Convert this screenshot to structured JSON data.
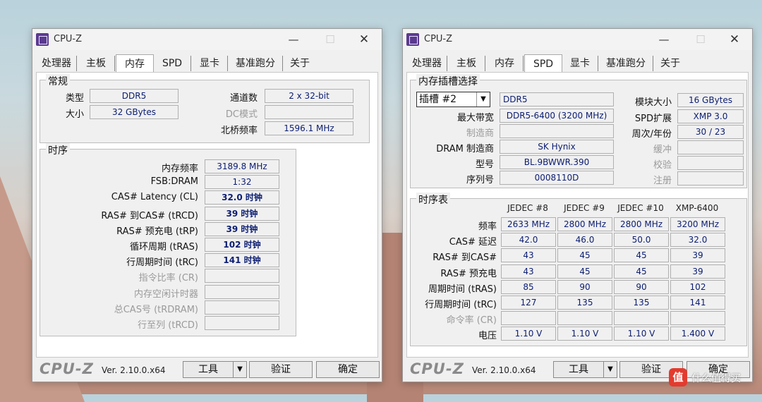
{
  "app_title": "CPU-Z",
  "win1": {
    "tabs": [
      "处理器",
      "主板",
      "内存",
      "SPD",
      "显卡",
      "基准跑分",
      "关于"
    ],
    "active_tab": "内存",
    "general": {
      "title": "常规",
      "type_label": "类型",
      "type_value": "DDR5",
      "size_label": "大小",
      "size_value": "32 GBytes",
      "channels_label": "通道数",
      "channels_value": "2 x 32-bit",
      "dc_label": "DC模式",
      "dc_value": "",
      "nb_label": "北桥频率",
      "nb_value": "1596.1 MHz"
    },
    "timings": {
      "title": "时序",
      "rows": [
        {
          "label": "内存频率",
          "value": "3189.8 MHz",
          "disabled": false,
          "bold": false
        },
        {
          "label": "FSB:DRAM",
          "value": "1:32",
          "disabled": false,
          "bold": false
        },
        {
          "label": "CAS# Latency (CL)",
          "value": "32.0 时钟",
          "disabled": false,
          "bold": true
        },
        {
          "label": "RAS# 到CAS# (tRCD)",
          "value": "39 时钟",
          "disabled": false,
          "bold": true
        },
        {
          "label": "RAS# 预充电 (tRP)",
          "value": "39 时钟",
          "disabled": false,
          "bold": true
        },
        {
          "label": "循环周期 (tRAS)",
          "value": "102 时钟",
          "disabled": false,
          "bold": true
        },
        {
          "label": "行周期时间 (tRC)",
          "value": "141 时钟",
          "disabled": false,
          "bold": true
        },
        {
          "label": "指令比率 (CR)",
          "value": "",
          "disabled": true,
          "bold": false
        },
        {
          "label": "内存空闲计时器",
          "value": "",
          "disabled": true,
          "bold": false
        },
        {
          "label": "总CAS号 (tRDRAM)",
          "value": "",
          "disabled": true,
          "bold": false
        },
        {
          "label": "行至列 (tRCD)",
          "value": "",
          "disabled": true,
          "bold": false
        }
      ]
    },
    "bottom": {
      "logo": "CPU-Z",
      "version": "Ver. 2.10.0.x64",
      "tools": "工具",
      "validate": "验证",
      "ok": "确定"
    }
  },
  "win2": {
    "tabs": [
      "处理器",
      "主板",
      "内存",
      "SPD",
      "显卡",
      "基准跑分",
      "关于"
    ],
    "active_tab": "SPD",
    "slot": {
      "title": "内存插槽选择",
      "slot_value": "插槽 #2",
      "type_value": "DDR5",
      "maxbw_label": "最大带宽",
      "maxbw_value": "DDR5-6400 (3200 MHz)",
      "mfr_label": "制造商",
      "mfr_value": "",
      "dram_label": "DRAM 制造商",
      "dram_value": "SK Hynix",
      "part_label": "型号",
      "part_value": "BL.9BWWR.390",
      "serial_label": "序列号",
      "serial_value": "0008110D",
      "modsize_label": "模块大小",
      "modsize_value": "16 GBytes",
      "spdext_label": "SPD扩展",
      "spdext_value": "XMP 3.0",
      "week_label": "周次/年份",
      "week_value": "30 / 23",
      "buffer_label": "缓冲",
      "buffer_value": "",
      "check_label": "校验",
      "check_value": "",
      "reg_label": "注册",
      "reg_value": ""
    },
    "timing_table": {
      "title": "时序表",
      "columns": [
        "JEDEC #8",
        "JEDEC #9",
        "JEDEC #10",
        "XMP-6400"
      ],
      "rows": [
        {
          "label": "频率",
          "values": [
            "2633 MHz",
            "2800 MHz",
            "2800 MHz",
            "3200 MHz"
          ],
          "disabled": false
        },
        {
          "label": "CAS# 延迟",
          "values": [
            "42.0",
            "46.0",
            "50.0",
            "32.0"
          ],
          "disabled": false
        },
        {
          "label": "RAS# 到CAS#",
          "values": [
            "43",
            "45",
            "45",
            "39"
          ],
          "disabled": false
        },
        {
          "label": "RAS# 预充电",
          "values": [
            "43",
            "45",
            "45",
            "39"
          ],
          "disabled": false
        },
        {
          "label": "周期时间 (tRAS)",
          "values": [
            "85",
            "90",
            "90",
            "102"
          ],
          "disabled": false
        },
        {
          "label": "行周期时间 (tRC)",
          "values": [
            "127",
            "135",
            "135",
            "141"
          ],
          "disabled": false
        },
        {
          "label": "命令率 (CR)",
          "values": [
            "",
            "",
            "",
            ""
          ],
          "disabled": true
        },
        {
          "label": "电压",
          "values": [
            "1.10 V",
            "1.10 V",
            "1.10 V",
            "1.400 V"
          ],
          "disabled": false
        }
      ]
    },
    "bottom": {
      "logo": "CPU-Z",
      "version": "Ver. 2.10.0.x64",
      "tools": "工具",
      "validate": "验证",
      "ok": "确定"
    }
  },
  "brand": {
    "icon_text": "值",
    "text": "什么值得买"
  }
}
